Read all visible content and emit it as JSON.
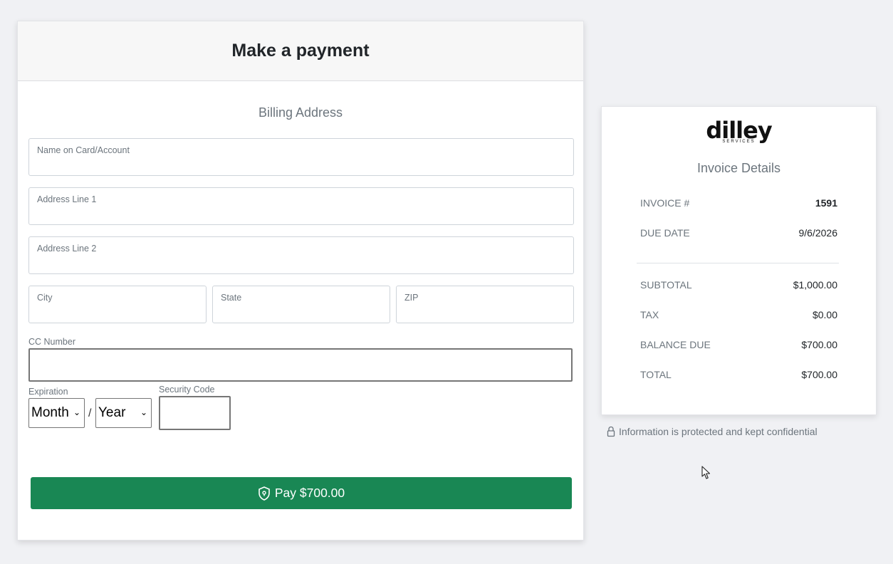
{
  "payment": {
    "title": "Make a payment",
    "section_title": "Billing Address",
    "fields": {
      "name": "Name on Card/Account",
      "address1": "Address Line 1",
      "address2": "Address Line 2",
      "city": "City",
      "state": "State",
      "zip": "ZIP"
    },
    "cc_label": "CC Number",
    "expiration_label": "Expiration",
    "month_value": "Month",
    "separator": "/",
    "year_value": "Year",
    "security_label": "Security Code",
    "pay_button": "Pay $700.00"
  },
  "invoice": {
    "logo_text": "dilley",
    "logo_sub": "SERVICES",
    "title": "Invoice Details",
    "rows": [
      {
        "label": "INVOICE #",
        "value": "1591"
      },
      {
        "label": "DUE DATE",
        "value": "9/6/2026"
      },
      {
        "label": "SUBTOTAL",
        "value": "$1,000.00"
      },
      {
        "label": "TAX",
        "value": "$0.00"
      },
      {
        "label": "BALANCE DUE",
        "value": "$700.00"
      },
      {
        "label": "TOTAL",
        "value": "$700.00"
      }
    ]
  },
  "secure_note": "Information is protected and kept confidential",
  "colors": {
    "accent_green": "#198754",
    "background": "#f0f1f4"
  }
}
